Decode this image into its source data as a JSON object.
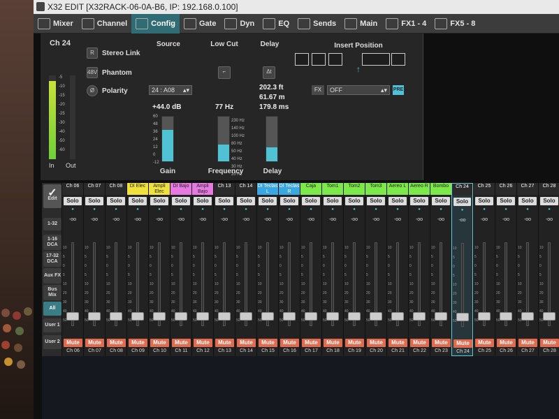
{
  "titlebar": {
    "title": "X32 EDIT [X32RACK-06-0A-B6, IP: 192.168.0.100]"
  },
  "tabs": [
    {
      "label": "Mixer",
      "icon": "mixer-icon",
      "active": false
    },
    {
      "label": "Channel",
      "icon": "channel-icon",
      "active": false
    },
    {
      "label": "Config",
      "icon": "config-icon",
      "active": true
    },
    {
      "label": "Gate",
      "icon": "gate-icon",
      "active": false
    },
    {
      "label": "Dyn",
      "icon": "dyn-icon",
      "active": false
    },
    {
      "label": "EQ",
      "icon": "eq-icon",
      "active": false
    },
    {
      "label": "Sends",
      "icon": "sends-icon",
      "active": false
    },
    {
      "label": "Main",
      "icon": "main-icon",
      "active": false
    },
    {
      "label": "FX1 - 4",
      "icon": "fx-icon",
      "active": false
    },
    {
      "label": "FX5 - 8",
      "icon": "fx-icon",
      "active": false
    }
  ],
  "config": {
    "channel": "Ch 24",
    "meter_scale": [
      "-5",
      "-10",
      "-15",
      "-20",
      "-25",
      "-30",
      "-40",
      "-50",
      "-60"
    ],
    "meter_in": "In",
    "meter_out": "Out",
    "stereo_link": "Stereo Link",
    "stereo_link_btn": "R",
    "phantom": "Phantom",
    "phantom_btn": "48V",
    "polarity": "Polarity",
    "polarity_btn": "Ø",
    "source_header": "Source",
    "source_value": "24 : A08",
    "lowcut_header": "Low Cut",
    "delay_header": "Delay",
    "delay_ft": "202.3 ft",
    "delay_m": "61.67 m",
    "delay_ms": "179.8 ms",
    "insert_header": "Insert Position",
    "insert_value": "OFF",
    "insert_fx_btn": "FX",
    "insert_pre": "PRE",
    "gain_value": "+44.0 dB",
    "gain_scale": [
      "60",
      "48",
      "36",
      "24",
      "12",
      "0",
      "-12"
    ],
    "gain_label": "Gain",
    "gain_level": 0.7,
    "freq_value": "77 Hz",
    "freq_scale": [
      "230 Hz",
      "140 Hz",
      "100 Hz",
      "80 Hz",
      "50 Hz",
      "40 Hz",
      "30 Hz",
      "20 Hz"
    ],
    "freq_label": "Frequency",
    "freq_level": 0.38,
    "delay_label": "Delay",
    "delay_level": 0.32
  },
  "leftnav": {
    "edit": "Edit",
    "buttons": [
      "1-32",
      "1-16 DCA",
      "17-32 DCA",
      "Aux FX",
      "Bus Mix",
      "All",
      "User 1",
      "User 2"
    ],
    "selected": "All"
  },
  "strips": [
    {
      "name": "Ch 06",
      "num": "Ch 06",
      "color": "#2a2a2a",
      "text": "#fff",
      "sel": false,
      "level": 0.12
    },
    {
      "name": "Ch 07",
      "num": "Ch 07",
      "color": "#2a2a2a",
      "text": "#fff",
      "sel": false,
      "level": 0.12
    },
    {
      "name": "Ch 08",
      "num": "Ch 08",
      "color": "#2a2a2a",
      "text": "#fff",
      "sel": false,
      "level": 0.12
    },
    {
      "name": "DI Elec",
      "num": "Ch 09",
      "color": "#f0e23c",
      "text": "#222",
      "sel": false,
      "level": 0.12
    },
    {
      "name": "Ampli Elec",
      "num": "Ch 10",
      "color": "#f0e23c",
      "text": "#222",
      "sel": false,
      "level": 0.12
    },
    {
      "name": "DI Bajo",
      "num": "Ch 11",
      "color": "#e77ae0",
      "text": "#222",
      "sel": false,
      "level": 0.12
    },
    {
      "name": "Ampli Bajo",
      "num": "Ch 12",
      "color": "#e77ae0",
      "text": "#222",
      "sel": false,
      "level": 0.12
    },
    {
      "name": "Ch 13",
      "num": "Ch 13",
      "color": "#2a2a2a",
      "text": "#fff",
      "sel": false,
      "level": 0.12
    },
    {
      "name": "Ch 14",
      "num": "Ch 14",
      "color": "#2a2a2a",
      "text": "#fff",
      "sel": false,
      "level": 0.12
    },
    {
      "name": "DI Teclas L",
      "num": "Ch 15",
      "color": "#3aa7e0",
      "text": "#fff",
      "sel": false,
      "level": 0.12
    },
    {
      "name": "DI Teclas R",
      "num": "Ch 16",
      "color": "#3aa7e0",
      "text": "#fff",
      "sel": false,
      "level": 0.12
    },
    {
      "name": "Caja",
      "num": "Ch 17",
      "color": "#7ce84a",
      "text": "#222",
      "sel": false,
      "level": 0.12
    },
    {
      "name": "Tom1",
      "num": "Ch 18",
      "color": "#7ce84a",
      "text": "#222",
      "sel": false,
      "level": 0.12
    },
    {
      "name": "Tom2",
      "num": "Ch 19",
      "color": "#7ce84a",
      "text": "#222",
      "sel": false,
      "level": 0.12
    },
    {
      "name": "Tom3",
      "num": "Ch 20",
      "color": "#7ce84a",
      "text": "#222",
      "sel": false,
      "level": 0.12
    },
    {
      "name": "Aereo L",
      "num": "Ch 21",
      "color": "#7ce84a",
      "text": "#222",
      "sel": false,
      "level": 0.12
    },
    {
      "name": "Aereo R",
      "num": "Ch 22",
      "color": "#7ce84a",
      "text": "#222",
      "sel": false,
      "level": 0.12
    },
    {
      "name": "Bombo",
      "num": "Ch 23",
      "color": "#7ce84a",
      "text": "#222",
      "sel": false,
      "level": 0.12
    },
    {
      "name": "Ch 24",
      "num": "Ch 24",
      "color": "#2a2a2a",
      "text": "#fff",
      "sel": true,
      "level": 0.12
    },
    {
      "name": "Ch 25",
      "num": "Ch 25",
      "color": "#2a2a2a",
      "text": "#fff",
      "sel": false,
      "level": 0.12
    },
    {
      "name": "Ch 26",
      "num": "Ch 26",
      "color": "#2a2a2a",
      "text": "#fff",
      "sel": false,
      "level": 0.12
    },
    {
      "name": "Ch 27",
      "num": "Ch 27",
      "color": "#2a2a2a",
      "text": "#fff",
      "sel": false,
      "level": 0.12
    },
    {
      "name": "Ch 28",
      "num": "Ch 28",
      "color": "#2a2a2a",
      "text": "#fff",
      "sel": false,
      "level": 0.12
    }
  ],
  "strip_labels": {
    "solo": "Solo",
    "mute": "Mute",
    "db": "-oo",
    "fader_scale": [
      "10",
      "5",
      "0",
      "5",
      "10",
      "20",
      "30",
      "40",
      "50"
    ]
  }
}
